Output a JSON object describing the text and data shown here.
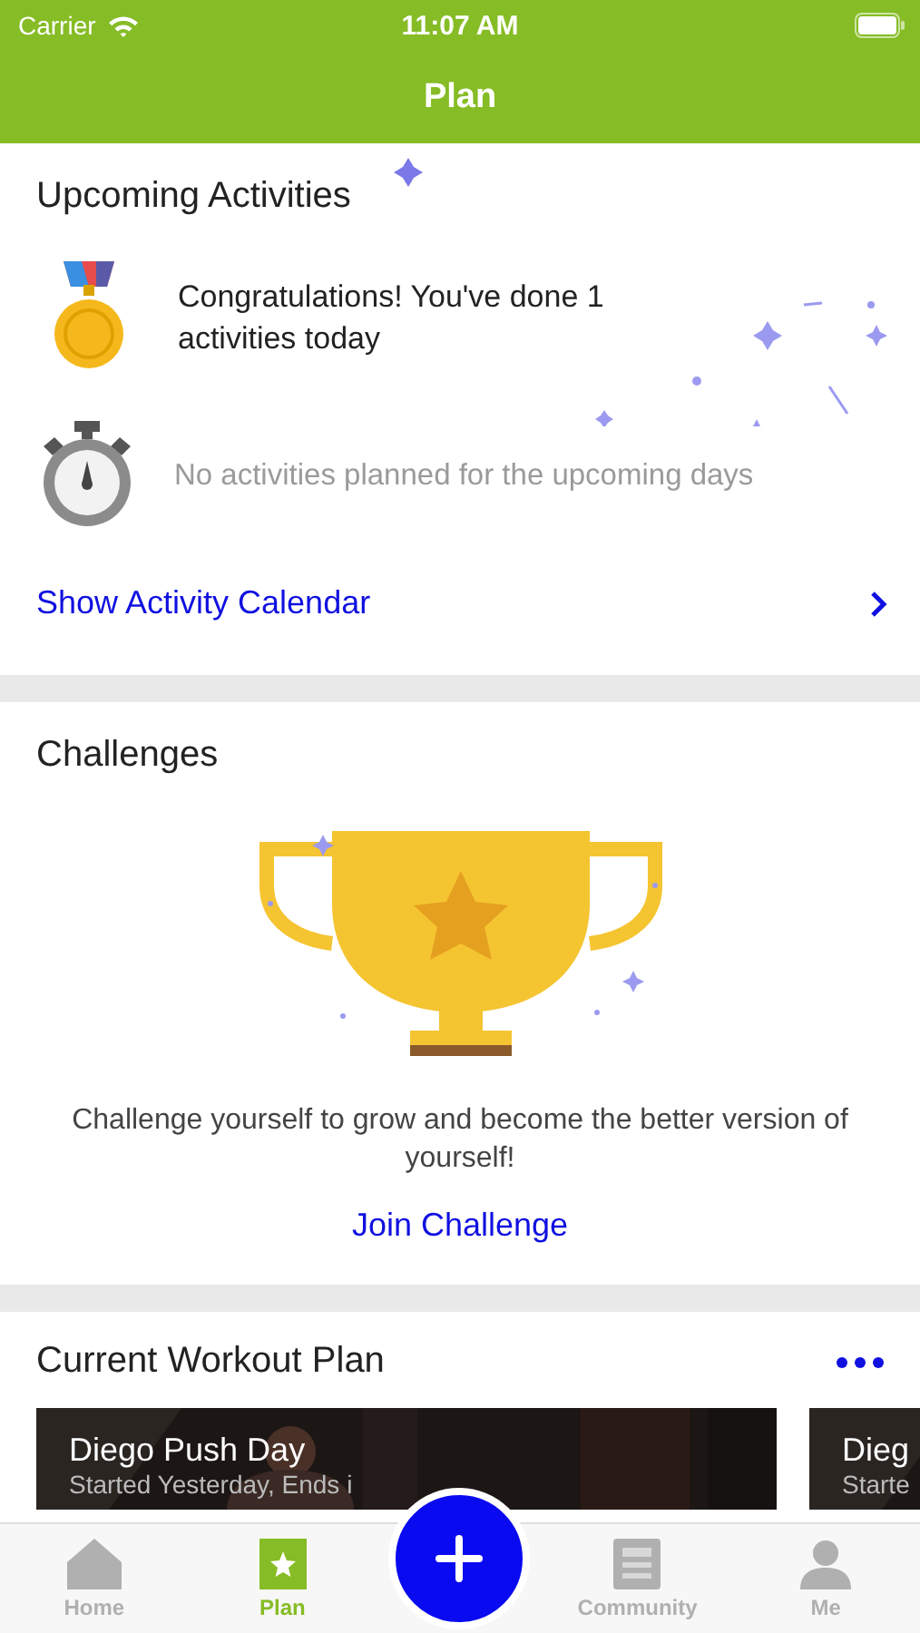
{
  "status_bar": {
    "carrier": "Carrier",
    "time": "11:07 AM"
  },
  "nav_bar": {
    "title": "Plan"
  },
  "upcoming": {
    "title": "Upcoming Activities",
    "items": [
      {
        "kind": "medal",
        "text": "Congratulations! You've done 1 activities today",
        "muted": false
      },
      {
        "kind": "stopwatch",
        "text": "No activities planned for the upcoming days",
        "muted": true
      }
    ],
    "link": "Show Activity Calendar"
  },
  "challenges": {
    "title": "Challenges",
    "message": "Challenge yourself to grow and become the better version of yourself!",
    "action": "Join Challenge"
  },
  "workout_plan": {
    "title": "Current Workout Plan",
    "cards": [
      {
        "kind": "picture",
        "title": "Diego Push Day",
        "subtitle": "Started Yesterday, Ends i"
      },
      {
        "kind": "picture",
        "title": "Dieg",
        "subtitle": "Starte"
      }
    ]
  },
  "tab_bar": {
    "items": [
      {
        "kind": "home",
        "label": "Home",
        "selected": false
      },
      {
        "kind": "plan",
        "label": "Plan",
        "selected": true
      },
      {
        "kind": "add",
        "selected": false
      },
      {
        "kind": "community",
        "label": "Community",
        "selected": false
      },
      {
        "kind": "me",
        "label": "Me",
        "selected": false
      }
    ]
  }
}
